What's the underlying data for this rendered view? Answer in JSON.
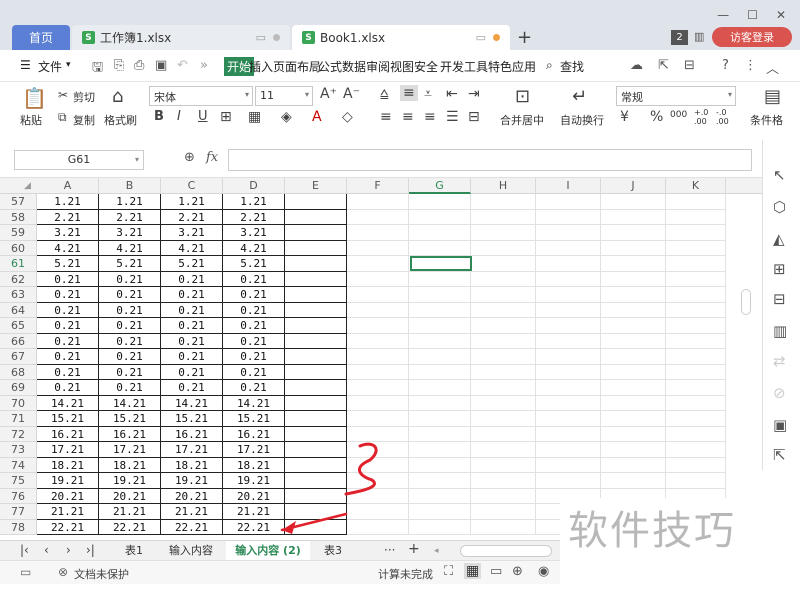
{
  "titlebar": {
    "tab_home": "首页",
    "tab_workbook": "工作簿1.xlsx",
    "tab_book1": "Book1.xlsx",
    "tab_icon_letter": "S",
    "add_tab": "+",
    "badge": "2",
    "visitor_login": "访客登录",
    "win_controls": [
      "—",
      "☐",
      "✕"
    ]
  },
  "menu": {
    "file": "文件",
    "items": [
      "开始",
      "插入",
      "页面布局",
      "公式",
      "数据",
      "审阅",
      "视图",
      "安全",
      "开发工具",
      "特色应用"
    ],
    "search": "查找"
  },
  "ribbon": {
    "paste": "粘贴",
    "cut": "剪切",
    "copy": "复制",
    "format_painter": "格式刷",
    "font_name": "宋体",
    "font_size": "11",
    "bold": "B",
    "italic": "I",
    "underline": "U",
    "merge_center": "合并居中",
    "wrap_text": "自动换行",
    "number_format": "常规",
    "percent": "%",
    "thousands": "000",
    "cond_format": "条件格"
  },
  "formula_bar": {
    "name_box": "G61",
    "fx": "fx"
  },
  "grid": {
    "columns": [
      "A",
      "B",
      "C",
      "D",
      "E",
      "F",
      "G",
      "H",
      "I",
      "J",
      "K"
    ],
    "selected_column": "G",
    "selected_row": "61",
    "rows": [
      {
        "n": "57",
        "v": "1.21"
      },
      {
        "n": "58",
        "v": "2.21"
      },
      {
        "n": "59",
        "v": "3.21"
      },
      {
        "n": "60",
        "v": "4.21"
      },
      {
        "n": "61",
        "v": "5.21"
      },
      {
        "n": "62",
        "v": "0.21"
      },
      {
        "n": "63",
        "v": "0.21"
      },
      {
        "n": "64",
        "v": "0.21"
      },
      {
        "n": "65",
        "v": "0.21"
      },
      {
        "n": "66",
        "v": "0.21"
      },
      {
        "n": "67",
        "v": "0.21"
      },
      {
        "n": "68",
        "v": "0.21"
      },
      {
        "n": "69",
        "v": "0.21"
      },
      {
        "n": "70",
        "v": "14.21"
      },
      {
        "n": "71",
        "v": "15.21"
      },
      {
        "n": "72",
        "v": "16.21"
      },
      {
        "n": "73",
        "v": "17.21"
      },
      {
        "n": "74",
        "v": "18.21"
      },
      {
        "n": "75",
        "v": "19.21"
      },
      {
        "n": "76",
        "v": "20.21"
      },
      {
        "n": "77",
        "v": "21.21"
      },
      {
        "n": "78",
        "v": "22.21"
      }
    ]
  },
  "sheets": {
    "tabs": [
      "表1",
      "输入内容",
      "输入内容 (2)",
      "表3"
    ],
    "active": "输入内容 (2)",
    "more": "···",
    "add": "+"
  },
  "status": {
    "doc_protect": "文档未保护",
    "calc_status": "计算未完成"
  },
  "annotation_color": "#e0202a",
  "watermark": "软件技巧"
}
